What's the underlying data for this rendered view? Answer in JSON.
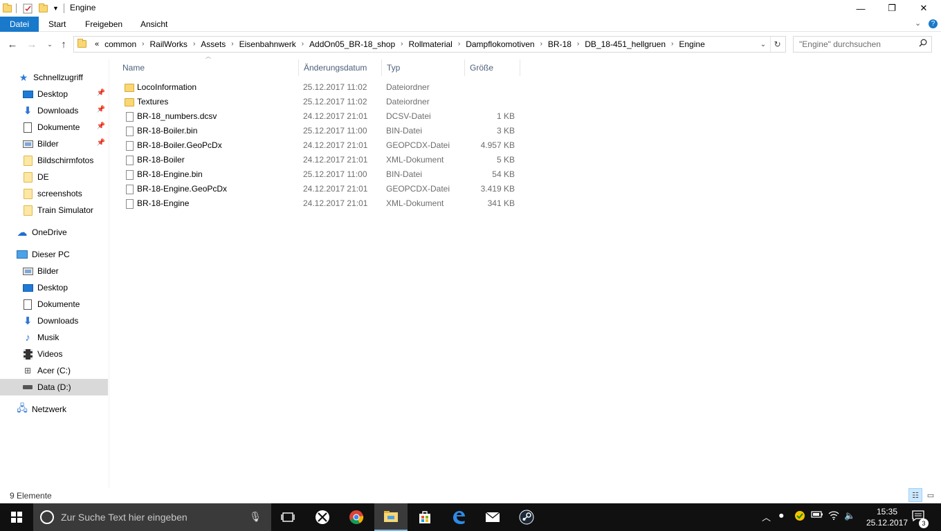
{
  "window": {
    "title": "Engine",
    "minimize_label": "—",
    "maximize_label": "❐",
    "close_label": "✕"
  },
  "ribbon": {
    "tabs": [
      "Datei",
      "Start",
      "Freigeben",
      "Ansicht"
    ],
    "active_tab": "Datei",
    "collapse_label": "⌄",
    "help_label": "?"
  },
  "address": {
    "overflow": "«",
    "crumbs": [
      "common",
      "RailWorks",
      "Assets",
      "Eisenbahnwerk",
      "AddOn05_BR-18_shop",
      "Rollmaterial",
      "Dampflokomotiven",
      "BR-18",
      "DB_18-451_hellgruen",
      "Engine"
    ],
    "separator": "›"
  },
  "search": {
    "placeholder": "\"Engine\" durchsuchen"
  },
  "nav": {
    "quick_access": "Schnellzugriff",
    "quick_items": [
      "Desktop",
      "Downloads",
      "Dokumente",
      "Bilder",
      "Bildschirmfotos",
      "DE",
      "screenshots",
      "Train Simulator"
    ],
    "onedrive": "OneDrive",
    "this_pc": "Dieser PC",
    "pc_items": [
      "Bilder",
      "Desktop",
      "Dokumente",
      "Downloads",
      "Musik",
      "Videos",
      "Acer (C:)",
      "Data (D:)"
    ],
    "network": "Netzwerk",
    "selected": "Data (D:)"
  },
  "columns": {
    "name": "Name",
    "date": "Änderungsdatum",
    "type": "Typ",
    "size": "Größe"
  },
  "files": [
    {
      "name": "LocoInformation",
      "date": "25.12.2017 11:02",
      "type": "Dateiordner",
      "size": "",
      "kind": "folder"
    },
    {
      "name": "Textures",
      "date": "25.12.2017 11:02",
      "type": "Dateiordner",
      "size": "",
      "kind": "folder"
    },
    {
      "name": "BR-18_numbers.dcsv",
      "date": "24.12.2017 21:01",
      "type": "DCSV-Datei",
      "size": "1 KB",
      "kind": "file"
    },
    {
      "name": "BR-18-Boiler.bin",
      "date": "25.12.2017 11:00",
      "type": "BIN-Datei",
      "size": "3 KB",
      "kind": "file"
    },
    {
      "name": "BR-18-Boiler.GeoPcDx",
      "date": "24.12.2017 21:01",
      "type": "GEOPCDX-Datei",
      "size": "4.957 KB",
      "kind": "file"
    },
    {
      "name": "BR-18-Boiler",
      "date": "24.12.2017 21:01",
      "type": "XML-Dokument",
      "size": "5 KB",
      "kind": "file"
    },
    {
      "name": "BR-18-Engine.bin",
      "date": "25.12.2017 11:00",
      "type": "BIN-Datei",
      "size": "54 KB",
      "kind": "file"
    },
    {
      "name": "BR-18-Engine.GeoPcDx",
      "date": "24.12.2017 21:01",
      "type": "GEOPCDX-Datei",
      "size": "3.419 KB",
      "kind": "file"
    },
    {
      "name": "BR-18-Engine",
      "date": "24.12.2017 21:01",
      "type": "XML-Dokument",
      "size": "341 KB",
      "kind": "file"
    }
  ],
  "status": {
    "count": "9 Elemente"
  },
  "taskbar": {
    "search_placeholder": "Zur Suche Text hier eingeben",
    "time": "15:35",
    "date": "25.12.2017",
    "notification_count": "3"
  },
  "colors": {
    "accent": "#1979ca",
    "selection": "#d9d9d9",
    "taskbar": "#101010"
  }
}
